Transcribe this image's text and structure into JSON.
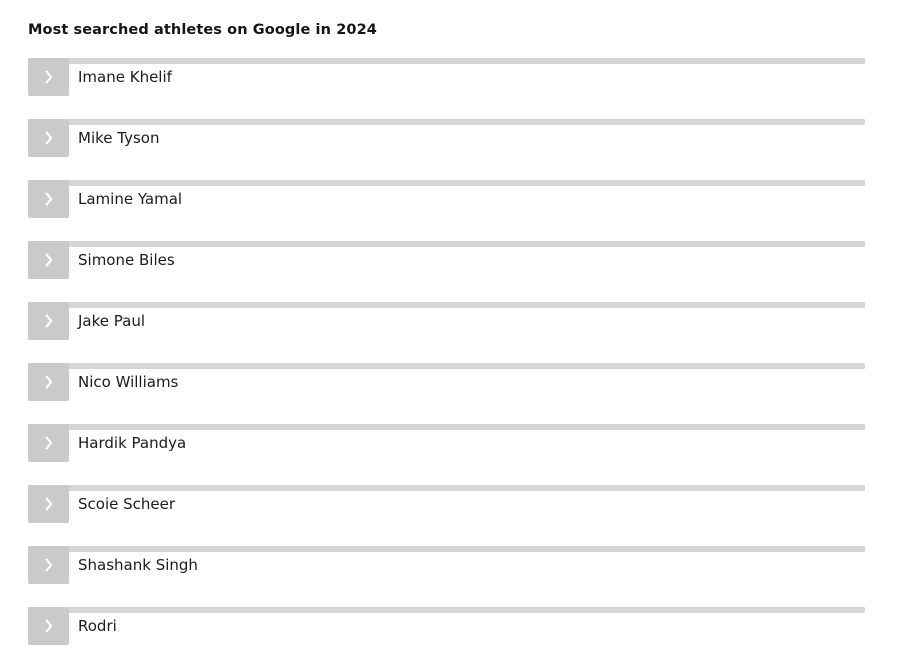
{
  "header": {
    "title": "Most searched athletes on Google in 2024"
  },
  "list": {
    "expand_icon": "chevron-right-icon",
    "items": [
      {
        "name": "Imane Khelif"
      },
      {
        "name": "Mike Tyson"
      },
      {
        "name": "Lamine Yamal"
      },
      {
        "name": "Simone Biles"
      },
      {
        "name": "Jake Paul"
      },
      {
        "name": "Nico Williams"
      },
      {
        "name": "Hardik Pandya"
      },
      {
        "name": "Scoie Scheer"
      },
      {
        "name": "Shashank Singh"
      },
      {
        "name": "Rodri"
      }
    ]
  },
  "colors": {
    "page_background": "#ffffff",
    "title_text": "#151515",
    "item_text": "#1c1c1c",
    "rule": "#d6d6d6",
    "button_fill": "#cacaca",
    "chevron": "#ffffff"
  }
}
